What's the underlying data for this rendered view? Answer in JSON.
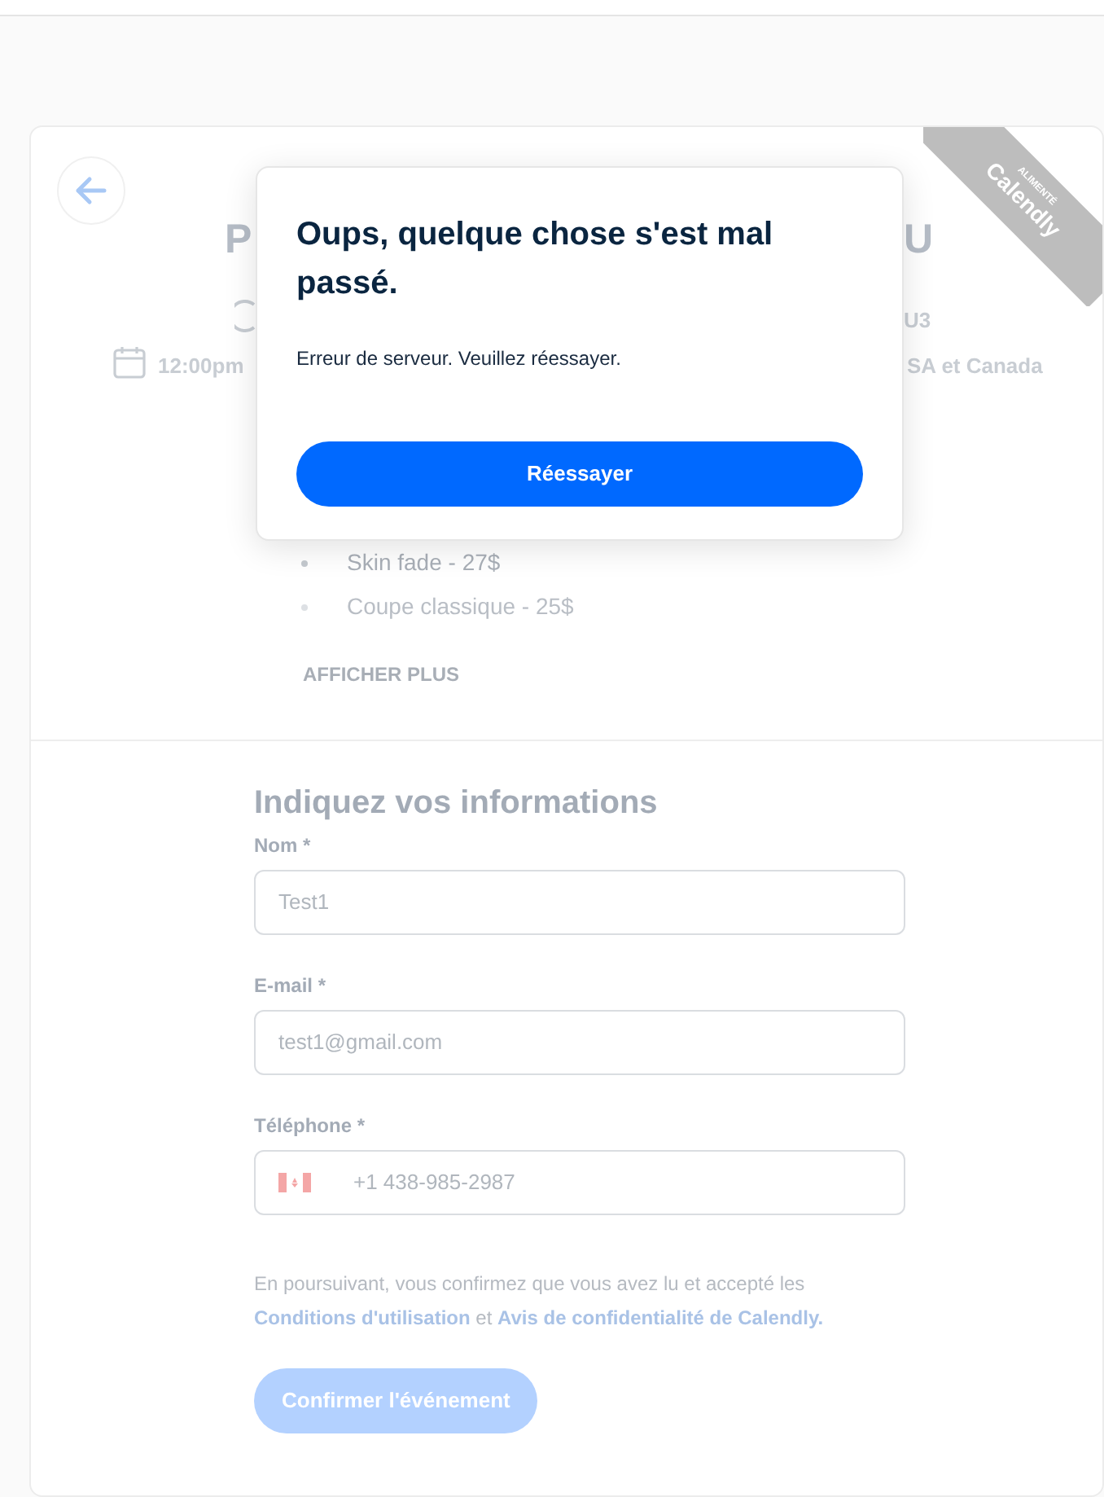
{
  "ribbon": {
    "caption": "ALIMENTÉ",
    "brand": "Calendly"
  },
  "event": {
    "title_start": "P",
    "title_end": "U",
    "duration_end": "U3",
    "time": "12:00pm",
    "timezone_end": "SA et Canada"
  },
  "services": [
    "Skin fade - 27$",
    "Coupe classique - 25$"
  ],
  "show_more": "AFFICHER PLUS",
  "form": {
    "heading": "Indiquez vos informations",
    "fields": [
      {
        "kind": "text",
        "label": "Nom *",
        "value": "Test1"
      },
      {
        "kind": "text",
        "label": "E-mail *",
        "value": "test1@gmail.com"
      },
      {
        "kind": "phone",
        "label": "Téléphone *",
        "value": "+1 438-985-2987"
      }
    ],
    "terms_before": "En poursuivant, vous confirmez que vous avez lu et accepté les",
    "terms_link_1": "Conditions d'utilisation",
    "terms_and": "et",
    "terms_link_2": "Avis de confidentialité de Calendly.",
    "submit": {
      "label": "Confirmer l'événement",
      "disabled": true
    }
  },
  "dialog": {
    "title": "Oups, quelque chose s'est mal passé.",
    "message": "Erreur de serveur. Veuillez réessayer.",
    "button": "Réessayer"
  }
}
